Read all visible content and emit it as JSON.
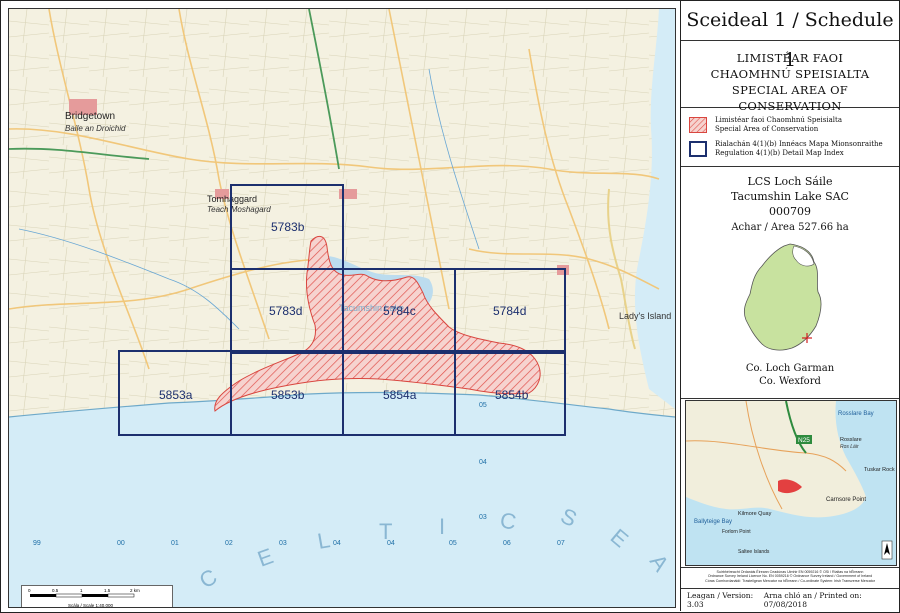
{
  "header": {
    "title": "Sceideal 1 / Schedule 1"
  },
  "sac_heading": {
    "line1": "LIMISTÉAR FAOI",
    "line2": "CHAOMHNÚ SPEISIALTA",
    "line3": "SPECIAL AREA OF CONSERVATION"
  },
  "legend": {
    "sac_ga": "Limistéar faoi Chaomhnú Speisialta",
    "sac_en": "Special Area of Conservation",
    "index_ga": "Rialachán 4(1)(b) Innéacs Mapa Mionsonraithe",
    "index_en": "Regulation 4(1)(b) Detail Map Index"
  },
  "site": {
    "name_ga": "LCS Loch Sáile",
    "name_en": "Tacumshin Lake SAC",
    "code": "000709",
    "area": "Achar / Area 527.66 ha",
    "county_ga": "Co. Loch Garman",
    "county_en": "Co. Wexford"
  },
  "map_tiles": [
    "5783b",
    "5783d",
    "5784c",
    "5784d",
    "5853a",
    "5853b",
    "5854a",
    "5854b"
  ],
  "map_labels": {
    "sea_letters": [
      "C",
      "E",
      "L",
      "T",
      "I",
      "C",
      "S",
      "E",
      "A"
    ],
    "lake": "Tacumshin Lake",
    "lady_island": "Lady's Island",
    "tomhaggard": "Tomhaggard",
    "tomhaggard_ga": "Teach Moshagard",
    "bridgetown": "Bridgetown",
    "bridgetown_ga": "Baile an Droichid",
    "grid_x": [
      "99",
      "00",
      "01",
      "02",
      "03",
      "04",
      "05",
      "06",
      "07",
      "08"
    ],
    "grid_y": [
      "05",
      "04",
      "03"
    ]
  },
  "inset_labels": {
    "rosslare_bay": "Rosslare Bay",
    "rosslare": "Rosslare",
    "ros_lair": "Ros Láir",
    "road": "N25",
    "carnsore_point": "Carnsore Point",
    "tuskar_rock": "Tuskar Rock",
    "ballyteige_bay": "Ballyteige Bay",
    "saltee": "Saltee Islands",
    "forlorn_point": "Forlorn Point",
    "kilmore_quay": "Kilmore Quay"
  },
  "scalebar": {
    "ticks": [
      "0",
      "0.5",
      "1",
      "1.5",
      "2 km"
    ],
    "label": "Scála / Scale 1:40,000"
  },
  "credits": {
    "l1": "Suirbhéireacht Ordanáis Éireann Ceadúnas Uimhir EN 0059216 © OSi / Rialtas na hÉireann",
    "l2": "Ordnance Survey Ireland Licence No. EN 0059216 © Ordnance Survey Ireland / Government of Ireland",
    "l3": "Córas Comhordanáidí: Trasteilgean Mercator na hÉireann / Co-ordinate System: Irish Transverse Mercator"
  },
  "footer": {
    "version": "Leagan / Version: 3.03",
    "printed": "Arna chló an / Printed on: 07/08/2018"
  }
}
